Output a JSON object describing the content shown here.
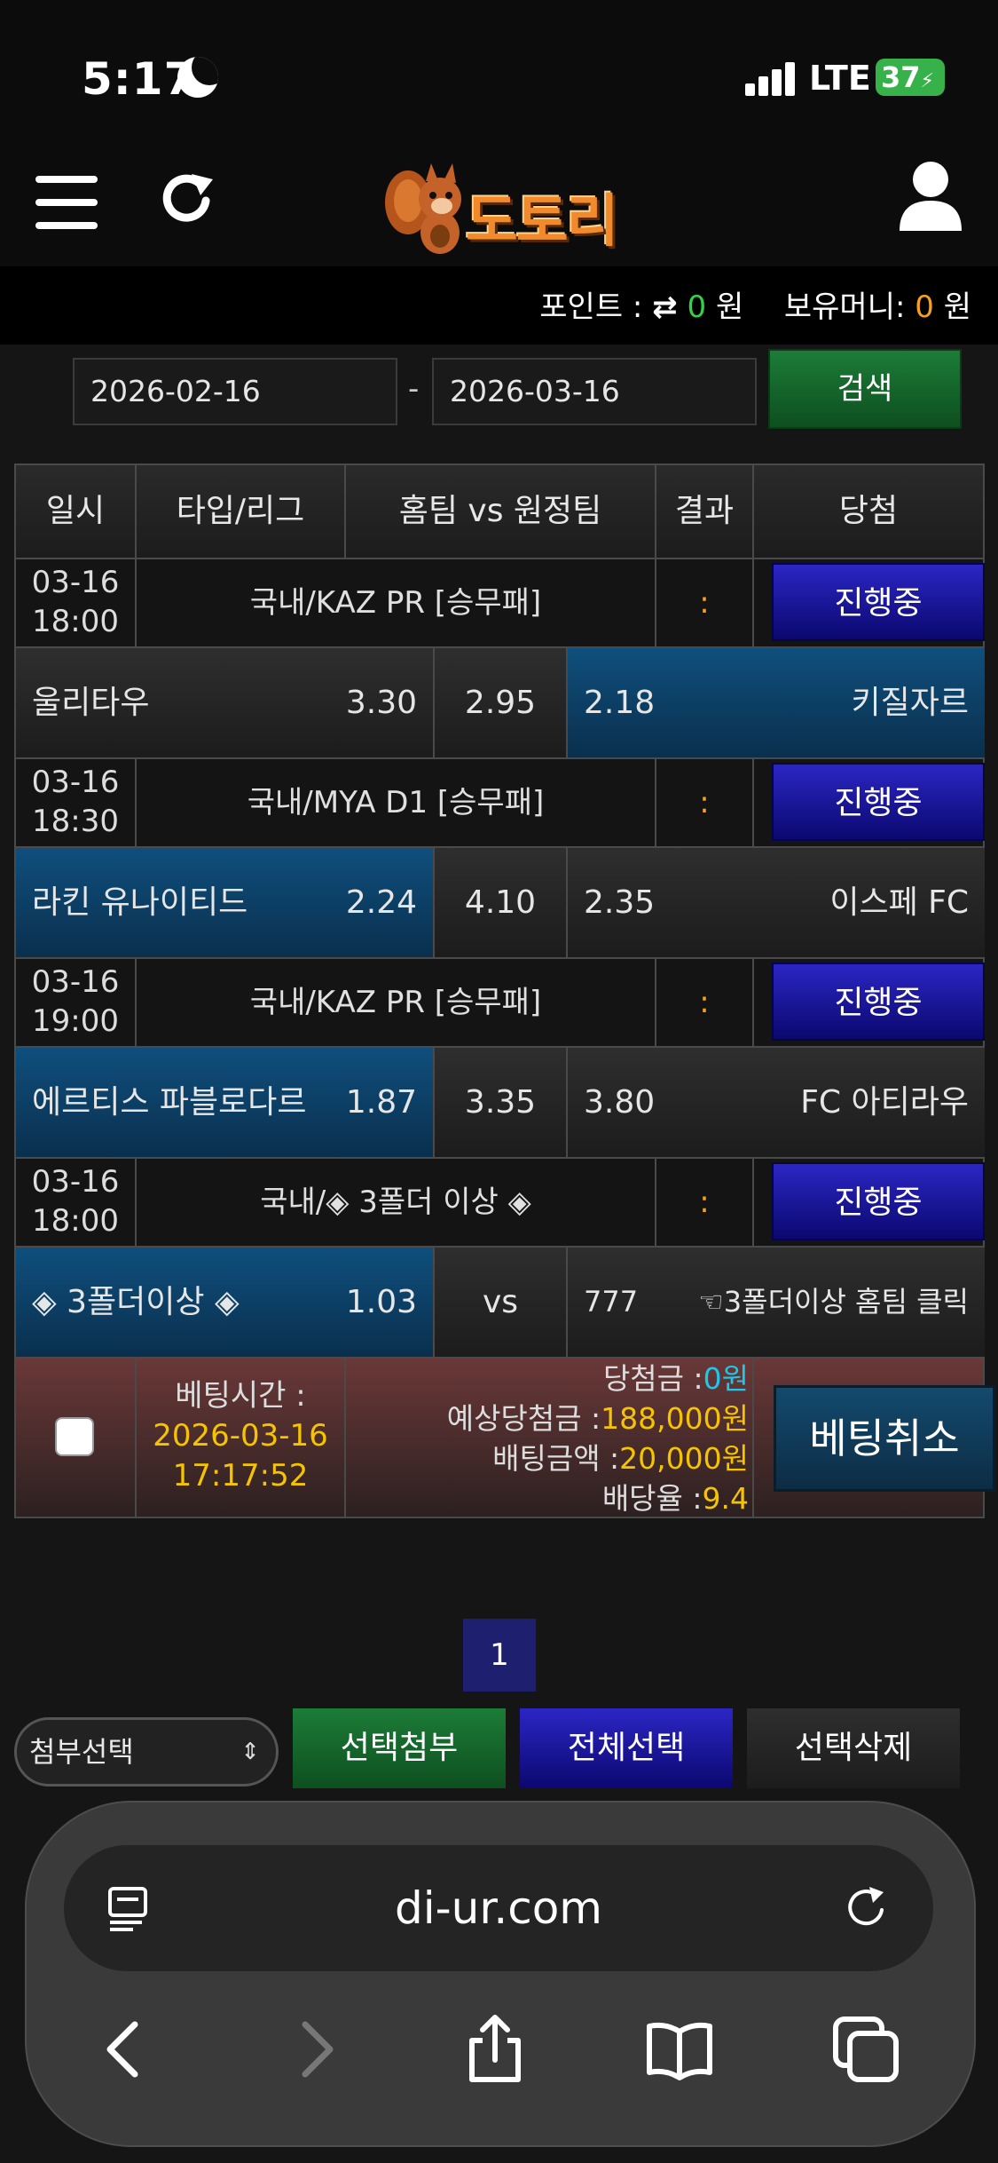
{
  "status_bar": {
    "time": "5:17",
    "network": "LTE",
    "battery": "37"
  },
  "header": {
    "logo_text": "도토리",
    "logo_icon": "squirrel-icon"
  },
  "points": {
    "points_label": "포인트 :",
    "points_value": "0",
    "points_unit": "원",
    "money_label": "보유머니:",
    "money_value": "0",
    "money_unit": "원"
  },
  "search": {
    "date_from": "2026-02-16",
    "separator": "-",
    "date_to": "2026-03-16",
    "button": "검색"
  },
  "table": {
    "headers": [
      "일시",
      "타입/리그",
      "홈팀 vs 원정팀",
      "결과",
      "당첨"
    ],
    "games": [
      {
        "date": "03-16",
        "time": "18:00",
        "league": "국내/KAZ PR [승무패]",
        "result": ":",
        "status": "진행중",
        "home": "울리타우",
        "home_odds": "3.30",
        "draw": "2.95",
        "away_odds": "2.18",
        "away": "키질자르",
        "selected": "away"
      },
      {
        "date": "03-16",
        "time": "18:30",
        "league": "국내/MYA D1 [승무패]",
        "result": ":",
        "status": "진행중",
        "home": "라킨 유나이티드",
        "home_odds": "2.24",
        "draw": "4.10",
        "away_odds": "2.35",
        "away": "이스페 FC",
        "selected": "home"
      },
      {
        "date": "03-16",
        "time": "19:00",
        "league": "국내/KAZ PR [승무패]",
        "result": ":",
        "status": "진행중",
        "home": "에르티스 파블로다르",
        "home_odds": "1.87",
        "draw": "3.35",
        "away_odds": "3.80",
        "away": "FC 아티라우",
        "selected": "home"
      },
      {
        "date": "03-16",
        "time": "18:00",
        "league": "국내/◈ 3폴더 이상 ◈",
        "result": ":",
        "status": "진행중",
        "home": "◈ 3폴더이상 ◈",
        "home_odds": "1.03",
        "draw": "vs",
        "away_odds": "777",
        "away": "☜3폴더이상 홈팀 클릭",
        "selected": "home"
      }
    ]
  },
  "bet_summary": {
    "time_label": "베팅시간 :",
    "date": "2026-03-16",
    "time": "17:17:52",
    "win_label": "당첨금 :",
    "win_value": "0원",
    "expected_label": "예상당첨금 :",
    "expected_value": "188,000원",
    "amount_label": "배팅금액 :",
    "amount_value": "20,000원",
    "rate_label": "배당율 :",
    "rate_value": "9.4",
    "cancel": "베팅취소"
  },
  "pagination": {
    "current": "1"
  },
  "actions": {
    "select_placeholder": "첨부선택",
    "attach": "선택첨부",
    "select_all": "전체선택",
    "delete": "선택삭제"
  },
  "browser": {
    "url": "di-ur.com"
  },
  "colors": {
    "accent_green": "#35d04a",
    "accent_orange": "#f4a21d",
    "status_blue": "#2b26c4",
    "selected_odds": "#0f4f7d"
  }
}
